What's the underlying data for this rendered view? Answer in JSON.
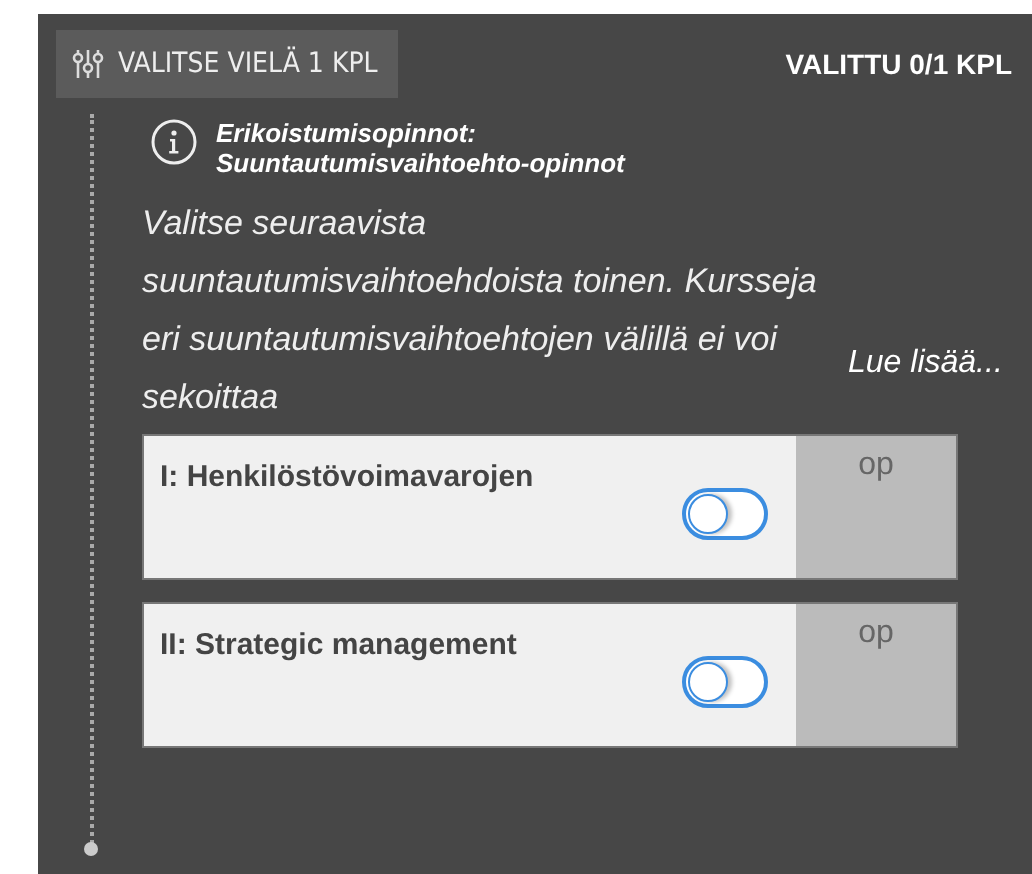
{
  "header": {
    "remaining": "VALITSE VIELÄ 1 KPL",
    "selected_count": "VALITTU 0/1 KPL"
  },
  "info": {
    "title_lines": [
      "Erikoistumisopinnot:",
      "Suuntautumisvaihtoehto-opinnot"
    ],
    "description": "Valitse seuraavista suuntautumisvaihtoehdoista toinen. Kursseja eri suuntautumisvaihtoehtojen välillä ei voi sekoittaa",
    "read_more": "Lue lisää..."
  },
  "options": [
    {
      "label": "I: Henkilöstövoimavarojen",
      "on": false,
      "credits_unit": "op"
    },
    {
      "label": "II: Strategic management",
      "on": false,
      "credits_unit": "op"
    }
  ]
}
